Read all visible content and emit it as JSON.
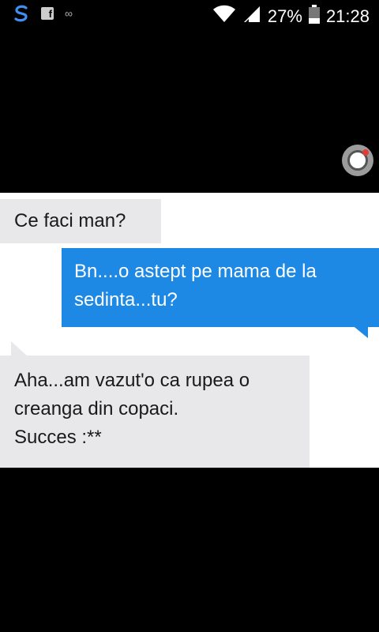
{
  "status_bar": {
    "app_icons": [
      "s-app-icon",
      "facebook-icon",
      "infinity-icon"
    ],
    "battery_percent": "27%",
    "clock": "21:28",
    "icons": [
      "wifi-icon",
      "signal-icon",
      "battery-icon"
    ]
  },
  "chat": {
    "messages": [
      {
        "direction": "incoming",
        "lines": [
          "Ce faci man?"
        ]
      },
      {
        "direction": "outgoing",
        "lines": [
          "Bn....o astept pe mama de la",
          "sedinta...tu?"
        ]
      },
      {
        "direction": "incoming",
        "lines": [
          "Aha...am vazut'o ca rupea o",
          "creanga din copaci.",
          "Succes :**"
        ]
      }
    ]
  },
  "colors": {
    "outgoing_bubble": "#1e88e5",
    "incoming_bubble": "#e8e8ea",
    "record_dot": "#e53935"
  }
}
